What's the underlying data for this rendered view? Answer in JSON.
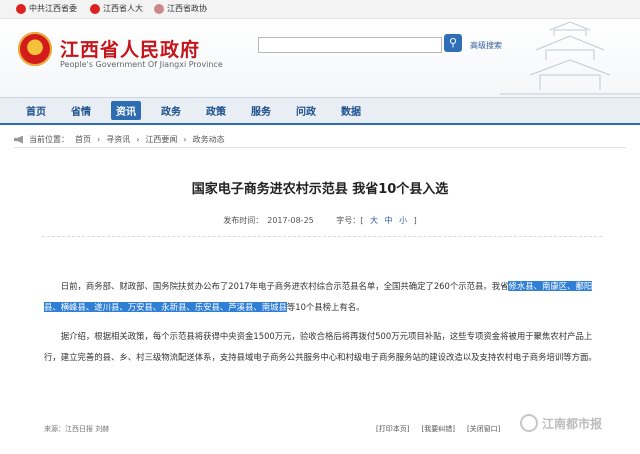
{
  "top_links": [
    "中共江西省委",
    "江西省人大",
    "江西省政协"
  ],
  "header": {
    "title": "江西省人民政府",
    "subtitle": "People's Government Of Jiangxi Province",
    "search_placeholder": "",
    "search_icon": "search-icon",
    "advanced_search": "高级搜索"
  },
  "nav": [
    "首页",
    "省情",
    "资讯",
    "政务",
    "政策",
    "服务",
    "问政",
    "数据"
  ],
  "breadcrumb": {
    "prefix": "当前位置：",
    "items": [
      "首页",
      "寻资讯",
      "江西要闻",
      "政务动态"
    ],
    "sep": "›"
  },
  "article": {
    "title": "国家电子商务进农村示范县 我省10个县入选",
    "date_label": "发布时间：",
    "date": "2017-08-25",
    "font_label": "字号：[",
    "font_sizes": [
      "大",
      "中",
      "小"
    ],
    "font_close": "]",
    "p1_before": "日前，商务部、财政部、国务院扶贫办公布了2017年电子商务进农村综合示范县名单，全国共确定了260个示范县。我省",
    "p1_highlight1": "修",
    "p1_highlight2": "水县、南康区、鄱阳县、横峰县、遂川县、万安县、永新县、乐安县、芦溪县、南城县",
    "p1_after": "等10个县榜上有名。",
    "p2": "据介绍，根据相关政策，每个示范县将获得中央资金1500万元，验收合格后将再拨付500万元项目补贴，这些专项资金将被用于聚焦农村产品上行，建立完善的县、乡、村三级物流配送体系，支持县域电子商务公共服务中心和村级电子商务服务站的建设改造以及支持农村电子商务培训等方面。",
    "source": "来源：江西日报 刘赫"
  },
  "tools": [
    "[打印本页]",
    "[我要纠错]",
    "[关闭窗口]"
  ],
  "watermark": "江南都市报",
  "colors": {
    "brand_red": "#c3151a",
    "nav_blue": "#2e6db2",
    "highlight": "#2f7fd6"
  }
}
